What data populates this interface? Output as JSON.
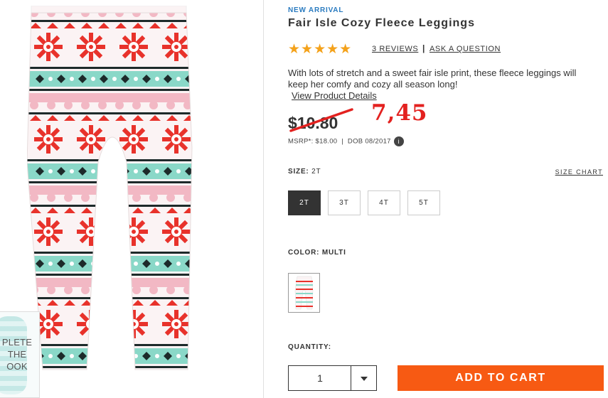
{
  "product": {
    "badge": "NEW ARRIVAL",
    "title": "Fair Isle Cozy Fleece Leggings",
    "rating_stars": "★★★★★",
    "reviews_link": "3 REVIEWS",
    "separator": "|",
    "ask_link": "ASK A QUESTION",
    "description": "With lots of stretch and a sweet fair isle print, these fleece leggings will keep her comfy and cozy all season long!",
    "view_details": "View Product Details"
  },
  "pricing": {
    "old_price": "$10.80",
    "new_price_handwritten": "7,45",
    "msrp": "MSRP*: $18.00  |  DOB 08/2017",
    "info_badge": "i"
  },
  "size": {
    "label": "SIZE:",
    "selected": "2T",
    "chart_link": "SIZE CHART",
    "options": [
      "2T",
      "3T",
      "4T",
      "5T"
    ]
  },
  "color": {
    "label": "COLOR:",
    "selected": "MULTI"
  },
  "quantity": {
    "label": "QUANTITY:",
    "value": "1"
  },
  "actions": {
    "add_to_cart": "ADD TO CART"
  },
  "complete_look": {
    "text": "PLETE\nTHE\nOOK"
  },
  "colors": {
    "accent_blue": "#2a7bc0",
    "star": "#f4a21b",
    "price_red": "#e3211f",
    "cta_orange": "#f75a13",
    "print_red": "#e8322b",
    "print_mint": "#8ad8c8",
    "print_pink": "#f2b8c4",
    "print_black": "#1d2a2a"
  }
}
